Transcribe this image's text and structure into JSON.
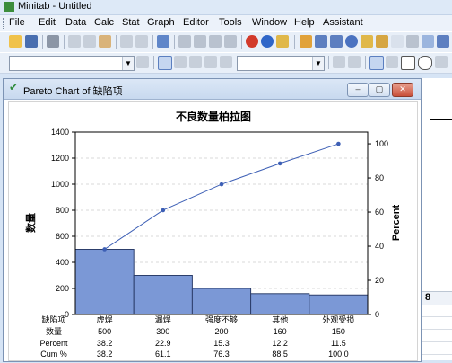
{
  "app": {
    "title": "Minitab - Untitled"
  },
  "menu": [
    "File",
    "Edit",
    "Data",
    "Calc",
    "Stat",
    "Graph",
    "Editor",
    "Tools",
    "Window",
    "Help",
    "Assistant"
  ],
  "graph_window": {
    "title": "Pareto Chart of 缺陷项"
  },
  "colors": {
    "bar_fill": "#7b98d6",
    "bar_stroke": "#2c3e6b",
    "line": "#3d5fb5",
    "accent_titlebar": "#dbe7f6"
  },
  "chart_data": {
    "type": "bar",
    "title": "不良数量柏拉图",
    "xlabel": "",
    "ylabel": "数量",
    "y2label": "Percent",
    "categories": [
      "虚焊",
      "漏焊",
      "强度不够",
      "其他",
      "外观受损"
    ],
    "values": [
      500,
      300,
      200,
      160,
      150
    ],
    "cum_percent": [
      38.2,
      61.1,
      76.3,
      88.5,
      100.0
    ],
    "ylim": [
      0,
      1400
    ],
    "yticks": [
      "0",
      "200",
      "400",
      "600",
      "800",
      "1000",
      "1200",
      "1400"
    ],
    "y2lim": [
      0,
      100
    ],
    "y2ticks": [
      "0",
      "20",
      "40",
      "60",
      "80",
      "100"
    ],
    "grid": true,
    "table": {
      "header_label": "缺陷项",
      "rows": [
        {
          "label": "数量",
          "cells": [
            "500",
            "300",
            "200",
            "160",
            "150"
          ]
        },
        {
          "label": "Percent",
          "cells": [
            "38.2",
            "22.9",
            "15.3",
            "12.2",
            "11.5"
          ]
        },
        {
          "label": "Cum %",
          "cells": [
            "38.2",
            "61.1",
            "76.3",
            "88.5",
            "100.0"
          ]
        }
      ]
    }
  },
  "background_sheet": {
    "visible_column": "8"
  }
}
